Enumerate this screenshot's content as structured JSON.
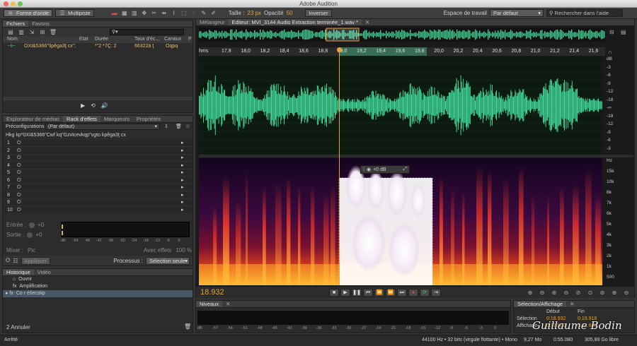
{
  "window": {
    "title": "Adobe Audition"
  },
  "toolbar": {
    "waveform_btn": "Forme d'onde",
    "multitrack_btn": "Multipiste",
    "size_label": "Taille :",
    "size_value": "23 px",
    "opacity_label": "Opacité",
    "opacity_value": "50",
    "invert_btn": "Inverser",
    "workspace_label": "Espace de travail",
    "workspace_value": "Par défaut",
    "search_placeholder": "Rechercher dans l'aide"
  },
  "files_panel": {
    "tabs": [
      "Fichiers",
      "Favoris"
    ],
    "columns": [
      "Nom",
      "Etat",
      "Durée",
      "Taux d'éc...",
      "Canaux",
      "P"
    ],
    "row": {
      "name": "OXI&5366\"\\lpêga3ţ cx\";",
      "duration": "*\"2 *7Ç: 2",
      "rate": "66322à ţ",
      "channels": "Oqpq"
    }
  },
  "effects_panel": {
    "tabs": [
      "Explorateur de médias",
      "Rack d'effets",
      "Marqueurs",
      "Propriétés"
    ],
    "preset_label": "Préconfigurations :",
    "preset_value": "(Par défaut)",
    "file_label": "Hkg kp*0XI&5366\"Cwf kq\"Gzvtcevkqp\"vgto kpêga3ţ cx",
    "slots": [
      "1",
      "2",
      "3",
      "4",
      "5",
      "6",
      "7",
      "8",
      "9",
      "10"
    ],
    "input_label": "Entrée :",
    "output_label": "Sortie :",
    "input_val": "+0",
    "output_val": "+0",
    "meter_scale": [
      "dB",
      "-54",
      "-48",
      "-42",
      "-36",
      "-30",
      "-24",
      "-18",
      "-12",
      "-6",
      "0"
    ],
    "mix_label": "Mixer :",
    "mix_val": "Pic",
    "with_effects": "Avec effets",
    "mix_pct": "100 %",
    "apply_btn": "Appliquer",
    "process_label": "Processus :",
    "process_value": "Sélection seule"
  },
  "history_panel": {
    "tabs": [
      "Historique",
      "Vidéo"
    ],
    "items": [
      "Ouvrir",
      "Amplification",
      "Co r éšecskp"
    ],
    "undo_count": "2 Annuler"
  },
  "status": {
    "left": "Arrêté",
    "format": "44100 Hz • 32 bits (virgule flottante) • Mono",
    "size": "9,27 Mo",
    "duration": "0:55.080",
    "free": "305,89 Go libre"
  },
  "editor": {
    "tabs": [
      "Mélangeur",
      "Editeur: MVI_3144 Audio Extraction terminée_1.wav *"
    ],
    "ruler_unit": "hms",
    "ruler": [
      "17,8",
      "18,0",
      "18,2",
      "18,4",
      "18,6",
      "18,8",
      "19,0",
      "19,2",
      "19,4",
      "19,6",
      "19,8",
      "20,0",
      "20,2",
      "20,4",
      "20,6",
      "20,8",
      "21,0",
      "21,2",
      "21,4",
      "21,6"
    ],
    "db_scale": [
      "dB",
      "-3",
      "-6",
      "-9",
      "-12",
      "-18",
      "-∞",
      "-18",
      "-12",
      "-9",
      "-6",
      "-3"
    ],
    "hz_scale": [
      "Hz",
      "15k",
      "10k",
      "8k",
      "7k",
      "6k",
      "5k",
      "4k",
      "3k",
      "2k",
      "1k",
      "500"
    ],
    "hud_gain": "+0 dB",
    "time_display": "18.932"
  },
  "levels_panel": {
    "tab": "Niveaux",
    "scale": [
      "dB",
      "-57",
      "-54",
      "-51",
      "-48",
      "-45",
      "-42",
      "-39",
      "-36",
      "-33",
      "-30",
      "-27",
      "-24",
      "-21",
      "-18",
      "-15",
      "-12",
      "-9",
      "-6",
      "-3",
      "0"
    ]
  },
  "selection_panel": {
    "tab": "Sélection/Affichage",
    "start_label": "Début",
    "end_label": "Fin",
    "selection_label": "Sélection",
    "selection_start": "0:18.932",
    "selection_end": "0:19.918",
    "view_label": "Affichage",
    "view_start": "0:17.800",
    "view_end": "0:21.660"
  },
  "watermark": "Guillaume Bodin",
  "colors": {
    "waveform": "#3fd598",
    "accent": "#e8a23a",
    "selection": "#ffffff"
  }
}
